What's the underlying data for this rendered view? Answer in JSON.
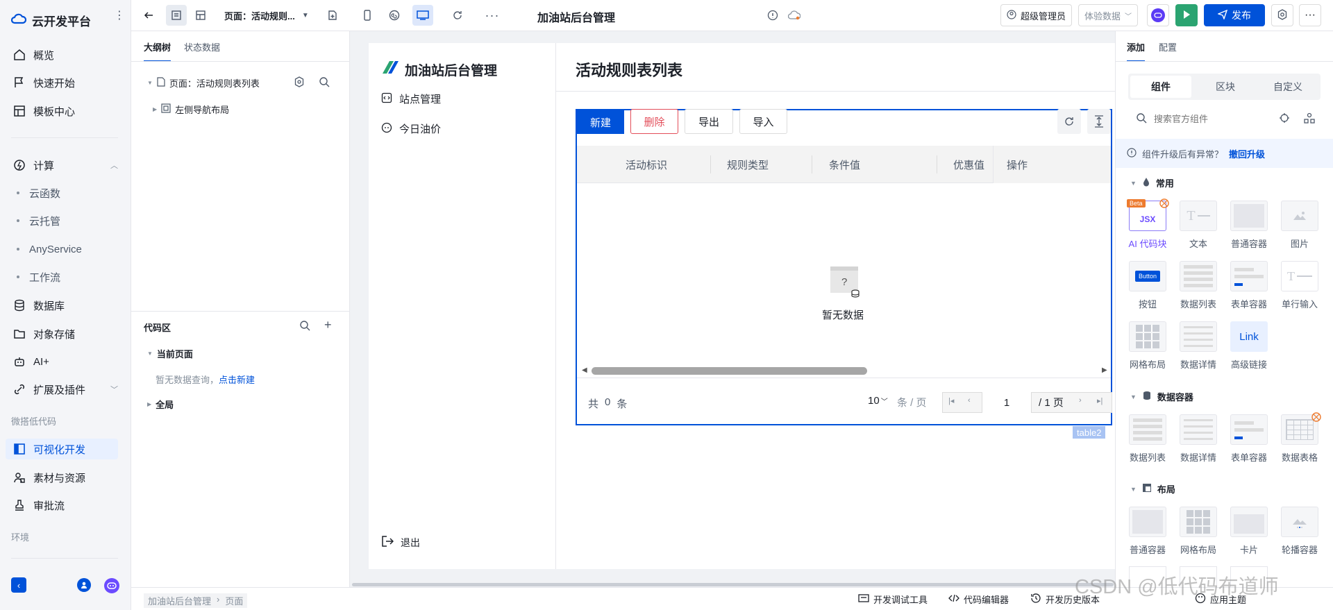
{
  "app": {
    "name": "云开发平台"
  },
  "nav": {
    "items": [
      {
        "label": "概览"
      },
      {
        "label": "快速开始"
      },
      {
        "label": "模板中心"
      },
      {
        "label": "计算"
      },
      {
        "label": "数据库"
      },
      {
        "label": "对象存储"
      },
      {
        "label": "AI+"
      },
      {
        "label": "扩展及插件"
      },
      {
        "label": "可视化开发"
      },
      {
        "label": "素材与资源"
      },
      {
        "label": "审批流"
      }
    ],
    "compute_sub": [
      {
        "label": "云函数"
      },
      {
        "label": "云托管"
      },
      {
        "label": "AnyService"
      },
      {
        "label": "工作流"
      }
    ],
    "sections": {
      "lowcode": "微搭低代码",
      "env": "环境"
    }
  },
  "topbar": {
    "page_selector": "页面：活动规则...",
    "title": "加油站后台管理",
    "user": "超级管理员",
    "data_mode": "体验数据",
    "publish": "发布"
  },
  "outline": {
    "tabs": [
      "大纲树",
      "状态数据"
    ],
    "page_node": "页面：活动规则表列表",
    "child_node": "左侧导航布局"
  },
  "code_area": {
    "title": "代码区",
    "current_page": "当前页面",
    "empty_text": "暂无数据查询，",
    "create_link": "点击新建",
    "global": "全局"
  },
  "preview": {
    "brand": "加油站后台管理",
    "menu": [
      {
        "label": "站点管理"
      },
      {
        "label": "今日油价"
      }
    ],
    "logout": "退出",
    "page_title": "活动规则表列表",
    "buttons": {
      "new": "新建",
      "delete": "删除",
      "export": "导出",
      "import": "导入"
    },
    "columns": [
      "活动标识",
      "规则类型",
      "条件值",
      "优惠值",
      "操作"
    ],
    "empty": "暂无数据",
    "pagination": {
      "total_prefix": "共",
      "total": "0",
      "total_suffix": "条",
      "page_size": "10",
      "per_page": "条 / 页",
      "current": "1",
      "pages": "/ 1 页"
    },
    "component_tag": "table2"
  },
  "right_panel": {
    "tabs": [
      "添加",
      "配置"
    ],
    "segments": [
      "组件",
      "区块",
      "自定义"
    ],
    "search_placeholder": "搜索官方组件",
    "notice": "组件升级后有异常？",
    "notice_link": "撤回升级",
    "groups": {
      "common": {
        "title": "常用",
        "items": [
          "AI 代码块",
          "文本",
          "普通容器",
          "图片",
          "按钮",
          "数据列表",
          "表单容器",
          "单行输入",
          "网格布局",
          "数据详情",
          "高级链接"
        ]
      },
      "data_container": {
        "title": "数据容器",
        "items": [
          "数据列表",
          "数据详情",
          "表单容器",
          "数据表格"
        ]
      },
      "layout": {
        "title": "布局",
        "items": [
          "普通容器",
          "网格布局",
          "卡片",
          "轮播容器"
        ]
      }
    },
    "badges": {
      "beta": "Beta",
      "jsx": "JSX",
      "button": "Button",
      "link": "Link"
    }
  },
  "bottom": {
    "breadcrumb": [
      "加油站后台管理",
      "页面"
    ],
    "tools": [
      "开发调试工具",
      "代码编辑器",
      "开发历史版本",
      "应用主题"
    ],
    "watermark": "CSDN @低代码布道师"
  }
}
